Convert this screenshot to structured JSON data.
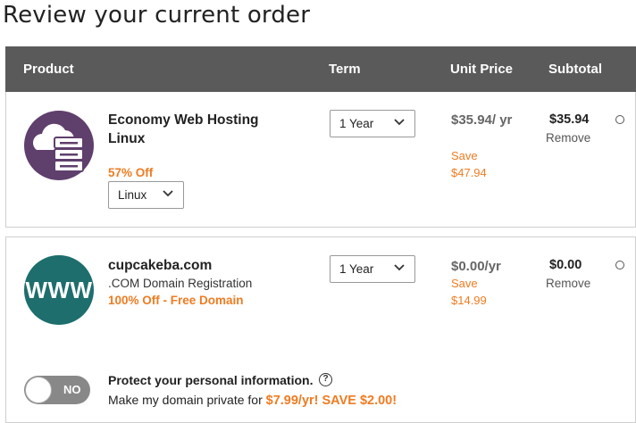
{
  "page": {
    "title": "Review your current order"
  },
  "table_header": {
    "product": "Product",
    "term": "Term",
    "unit_price": "Unit Price",
    "subtotal": "Subtotal"
  },
  "items": [
    {
      "name": "Economy Web Hosting Linux",
      "icon": "server-cloud-icon",
      "discount": "57% Off",
      "os_select": "Linux",
      "term": "1 Year",
      "unit_price": "$35.94/ yr",
      "save_label": "Save",
      "save_amount": "$47.94",
      "subtotal": "$35.94",
      "remove": "Remove"
    },
    {
      "name": "cupcakeba.com",
      "icon": "www-icon",
      "logo_text": "WWW",
      "description": ".COM Domain Registration",
      "discount": "100% Off - Free Domain",
      "term": "1 Year",
      "unit_price": "$0.00/yr",
      "save_label": "Save",
      "save_amount": "$14.99",
      "subtotal": "$0.00",
      "remove": "Remove"
    }
  ],
  "privacy": {
    "toggle_state": "NO",
    "title": "Protect your personal information.",
    "help": "?",
    "offer_prefix": "Make my domain private for ",
    "offer_highlight": "$7.99/yr! SAVE $2.00!"
  },
  "colors": {
    "header_bg": "#5a5a5a",
    "accent": "#ef7c22",
    "hosting_logo": "#5f3f6c",
    "domain_logo": "#1d6e6c"
  }
}
